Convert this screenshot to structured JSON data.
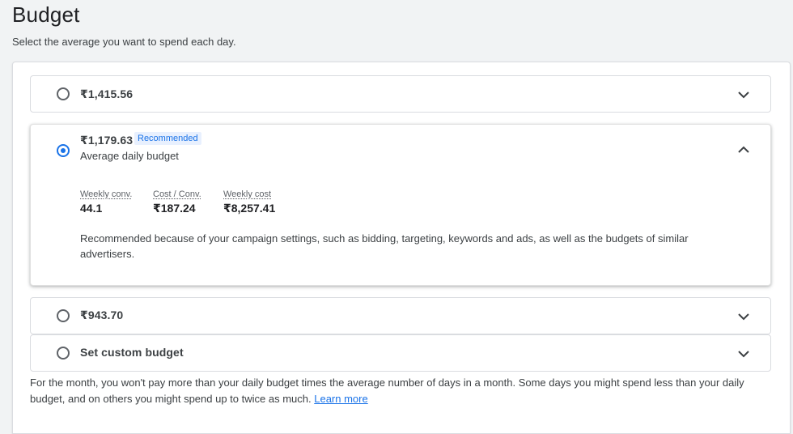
{
  "header": {
    "title": "Budget",
    "subtitle": "Select the average you want to spend each day."
  },
  "options": [
    {
      "amount": "₹1,415.56",
      "selected": false,
      "expanded": false
    },
    {
      "amount": "₹1,179.63",
      "selected": true,
      "expanded": true,
      "badge": "Recommended",
      "sub_label": "Average daily budget",
      "metrics": [
        {
          "label": "Weekly conv.",
          "value": "44.1"
        },
        {
          "label": "Cost / Conv.",
          "value": "₹187.24"
        },
        {
          "label": "Weekly cost",
          "value": "₹8,257.41"
        }
      ],
      "reason": "Recommended because of your campaign settings, such as bidding, targeting, keywords and ads, as well as the budgets of similar advertisers."
    },
    {
      "amount": "₹943.70",
      "selected": false,
      "expanded": false
    },
    {
      "amount": "Set custom budget",
      "selected": false,
      "expanded": false
    }
  ],
  "footer": {
    "note": "For the month, you won't pay more than your daily budget times the average number of days in a month. Some days you might spend less than your daily budget, and on others you might spend up to twice as much.",
    "link": "Learn more"
  },
  "icons": {
    "expand": "chevron-down-icon",
    "collapse": "chevron-up-icon"
  },
  "colors": {
    "accent": "#1a73e8",
    "badge_bg": "#e8f0fe",
    "text": "#3c4043"
  }
}
